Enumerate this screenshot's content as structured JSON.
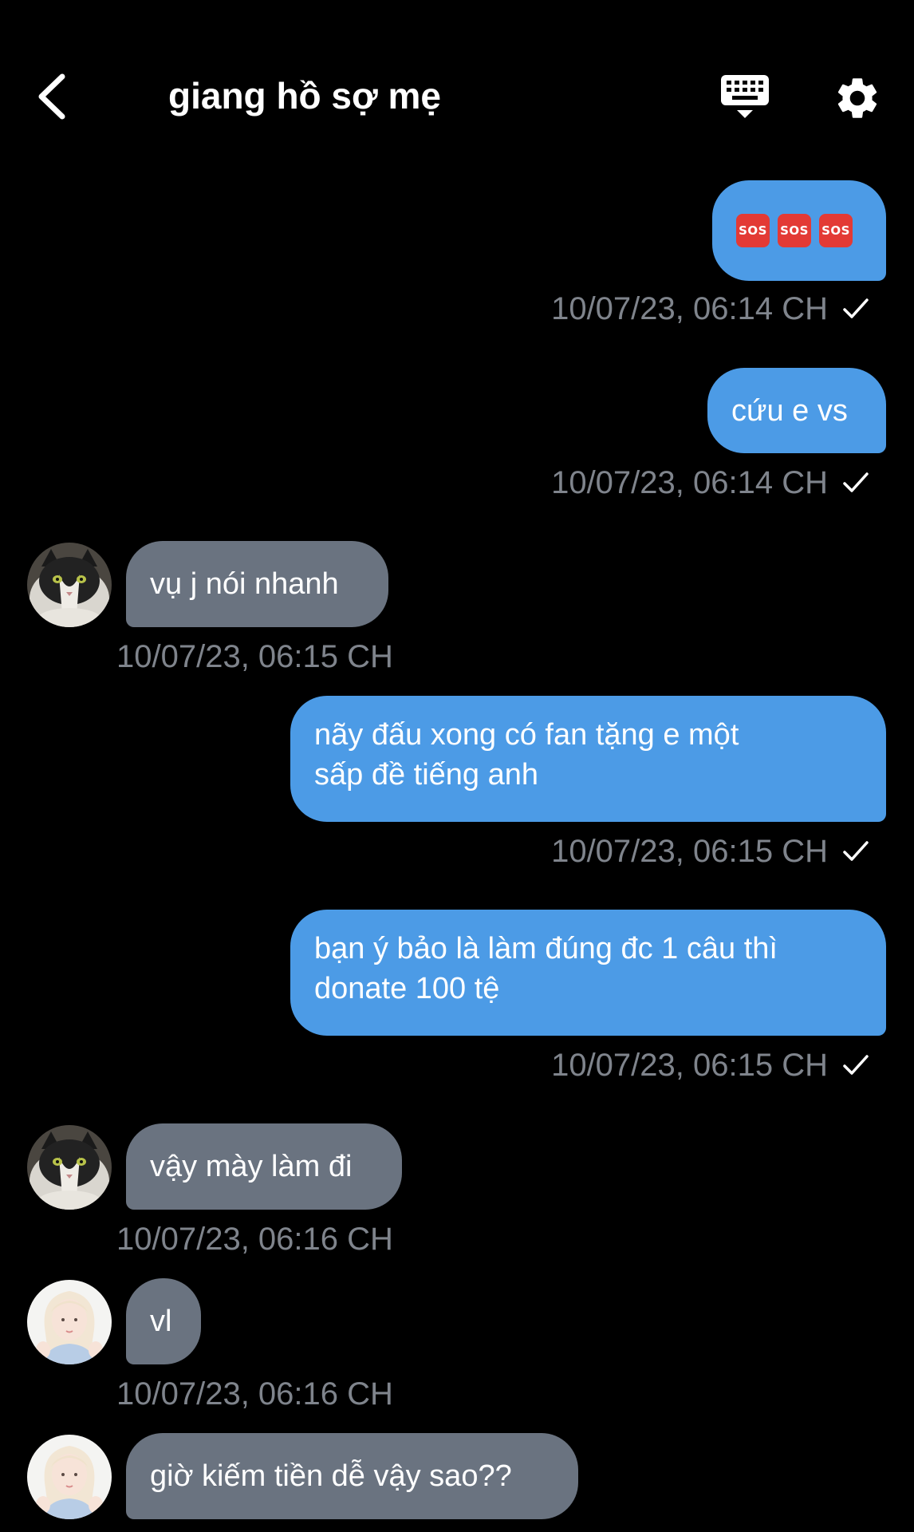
{
  "header": {
    "title": "giang hồ sợ mẹ",
    "back_icon": "chevron-left-icon",
    "keyboard_icon": "keyboard-icon",
    "settings_icon": "gear-icon"
  },
  "colors": {
    "background": "#000000",
    "outgoing_bubble": "#4c9be6",
    "incoming_bubble": "#6a7380",
    "timestamp": "#7f848c"
  },
  "messages": [
    {
      "direction": "out",
      "sos": [
        "SOS",
        "SOS",
        "SOS"
      ],
      "time": "10/07/23, 06:14 CH",
      "status_icon": "check-icon"
    },
    {
      "direction": "out",
      "text": "cứu e vs",
      "time": "10/07/23, 06:14 CH",
      "status_icon": "check-icon"
    },
    {
      "direction": "in",
      "avatar": "cat-avatar",
      "text": "vụ j nói nhanh",
      "time": "10/07/23, 06:15 CH"
    },
    {
      "direction": "out",
      "line1": "nãy đấu xong có fan tặng e một",
      "line2": "sấp đề tiếng anh",
      "time": "10/07/23, 06:15 CH",
      "status_icon": "check-icon"
    },
    {
      "direction": "out",
      "line1": "bạn ý bảo là làm đúng đc 1 câu thì",
      "line2": "donate 100 tệ",
      "time": "10/07/23, 06:15 CH",
      "status_icon": "check-icon"
    },
    {
      "direction": "in",
      "avatar": "cat-avatar",
      "text": "vậy mày làm đi",
      "time": "10/07/23, 06:16 CH"
    },
    {
      "direction": "in",
      "avatar": "girl-avatar",
      "text": "vl",
      "time": "10/07/23, 06:16 CH"
    },
    {
      "direction": "in",
      "avatar": "girl-avatar",
      "text": "giờ kiếm tiền dễ vậy sao??"
    }
  ]
}
